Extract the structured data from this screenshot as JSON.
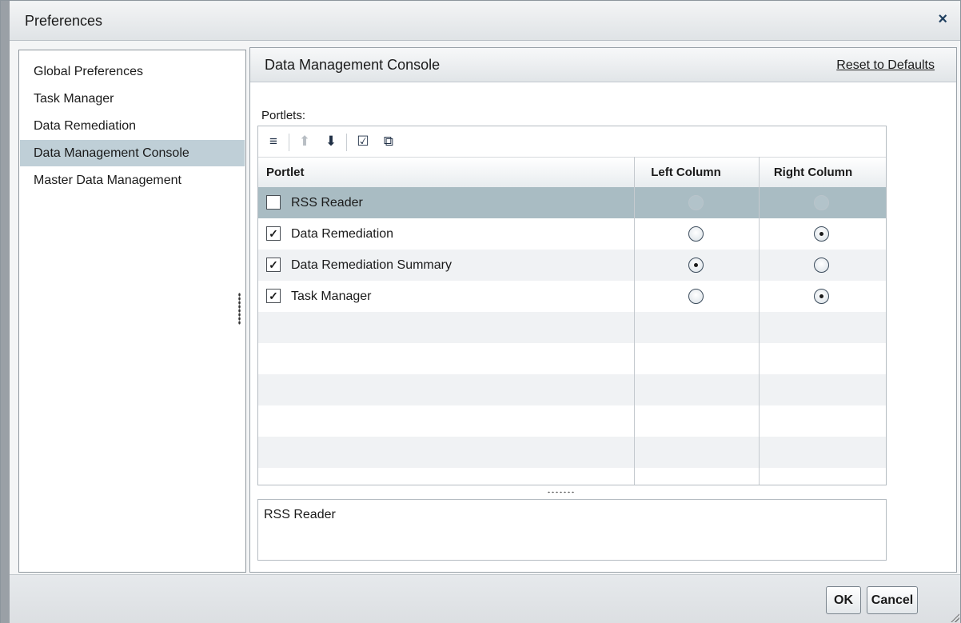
{
  "dialog": {
    "title": "Preferences",
    "close_icon": "×"
  },
  "nav": {
    "items": [
      {
        "label": "Global Preferences",
        "selected": false
      },
      {
        "label": "Task Manager",
        "selected": false
      },
      {
        "label": "Data Remediation",
        "selected": false
      },
      {
        "label": "Data Management Console",
        "selected": true
      },
      {
        "label": "Master Data Management",
        "selected": false
      }
    ]
  },
  "panel": {
    "title": "Data Management Console",
    "reset_label": "Reset to Defaults",
    "portlets_label": "Portlets:"
  },
  "toolbar": {
    "icons": [
      "menu-lines-icon",
      "move-up-icon",
      "move-down-icon",
      "edit-checkbox-icon",
      "restore-window-icon"
    ],
    "glyphs": {
      "menu": "≡",
      "up": "⬆",
      "down": "⬇",
      "edit": "☑",
      "restore": "⧉"
    },
    "up_enabled": false
  },
  "table": {
    "headers": {
      "portlet": "Portlet",
      "left": "Left Column",
      "right": "Right Column"
    },
    "rows": [
      {
        "label": "RSS Reader",
        "checked": false,
        "left": false,
        "right": false,
        "enabled": false,
        "selected": true
      },
      {
        "label": "Data Remediation",
        "checked": true,
        "left": false,
        "right": true,
        "enabled": true,
        "selected": false
      },
      {
        "label": "Data Remediation Summary",
        "checked": true,
        "left": true,
        "right": false,
        "enabled": true,
        "selected": false
      },
      {
        "label": "Task Manager",
        "checked": true,
        "left": false,
        "right": true,
        "enabled": true,
        "selected": false
      }
    ],
    "check_glyph": "✓"
  },
  "description": {
    "text": "RSS Reader"
  },
  "footer": {
    "ok_label": "OK",
    "cancel_label": "Cancel"
  },
  "colors": {
    "selection": "#a9bcc3",
    "nav_selection": "#bfcfd7",
    "accent": "#1f3f5f"
  }
}
